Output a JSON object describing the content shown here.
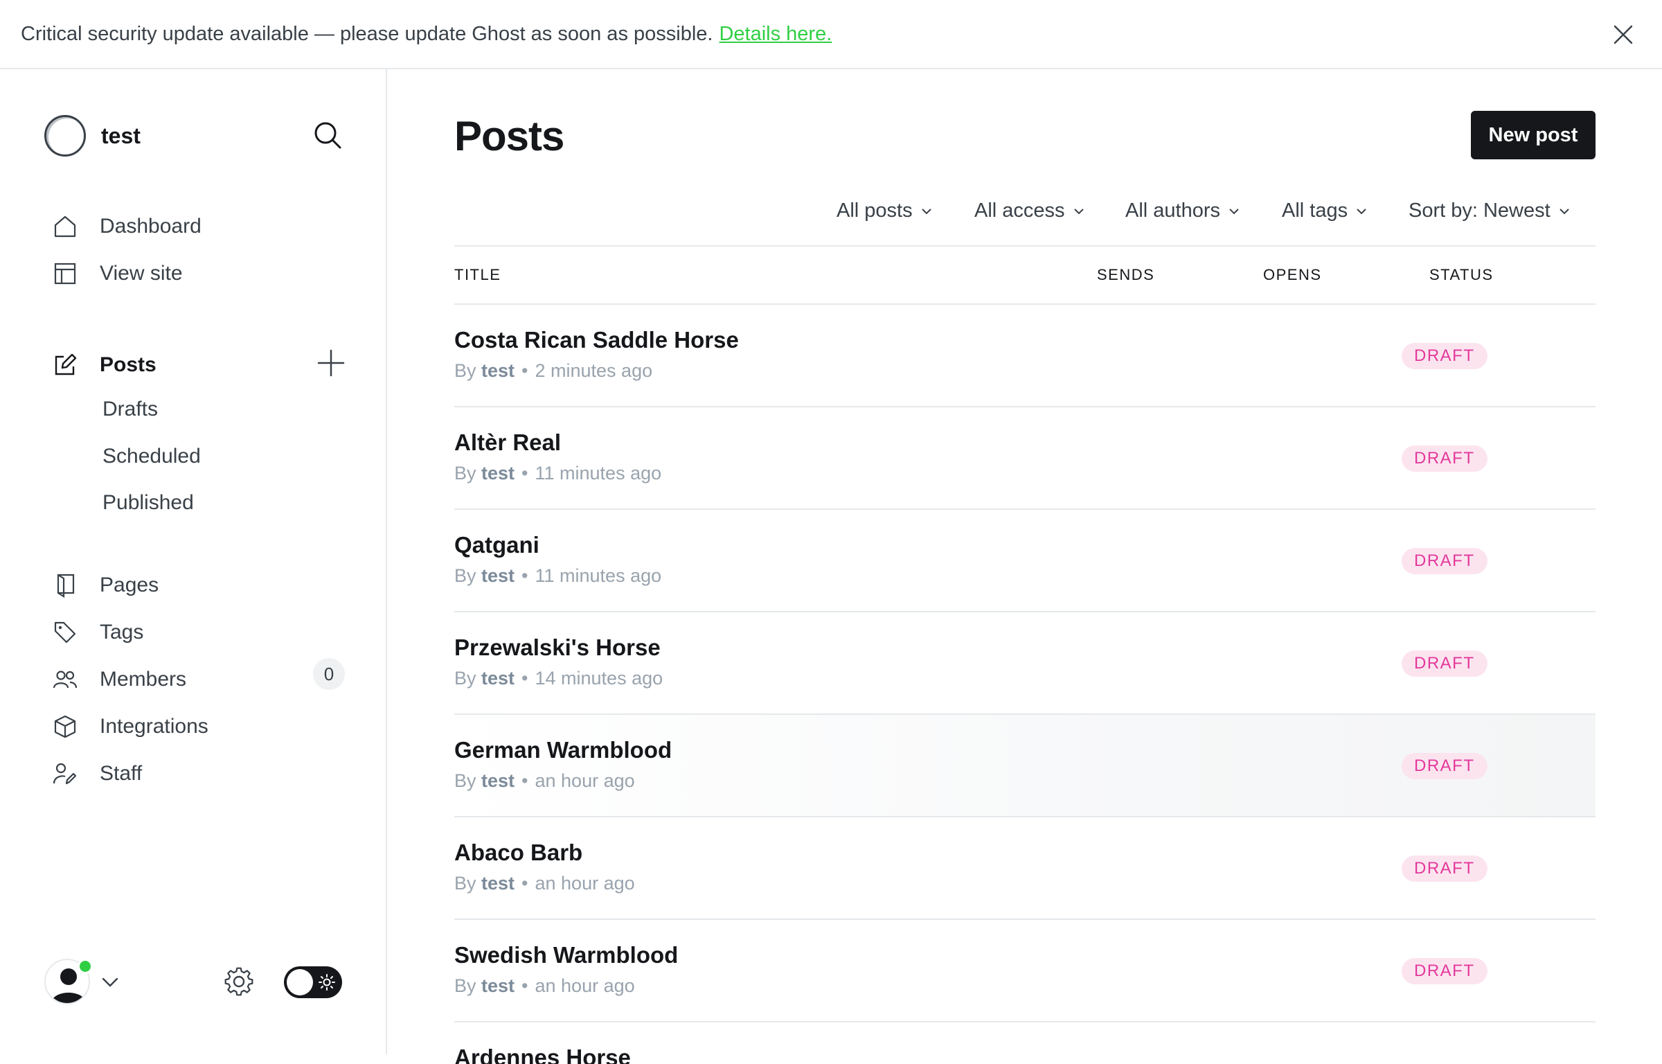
{
  "banner": {
    "message": "Critical security update available — please update Ghost as soon as possible.",
    "link_text": "Details here."
  },
  "sidebar": {
    "site_name": "test",
    "nav_primary": [
      {
        "label": "Dashboard",
        "icon": "home-icon"
      },
      {
        "label": "View site",
        "icon": "layout-icon"
      }
    ],
    "posts": {
      "label": "Posts",
      "icon": "edit-icon",
      "sub_items": [
        "Drafts",
        "Scheduled",
        "Published"
      ]
    },
    "nav_secondary": [
      {
        "label": "Pages",
        "icon": "page-icon"
      },
      {
        "label": "Tags",
        "icon": "tag-icon"
      },
      {
        "label": "Members",
        "icon": "members-icon",
        "count": "0"
      },
      {
        "label": "Integrations",
        "icon": "box-icon"
      },
      {
        "label": "Staff",
        "icon": "staff-icon"
      }
    ],
    "online_color": "#30cf43"
  },
  "main": {
    "title": "Posts",
    "new_post_label": "New post",
    "filters": [
      "All posts",
      "All access",
      "All authors",
      "All tags",
      "Sort by: Newest"
    ],
    "columns": [
      "TITLE",
      "SENDS",
      "OPENS",
      "STATUS"
    ],
    "posts": [
      {
        "title": "Costa Rican Saddle Horse",
        "by": "By",
        "author": "test",
        "time": "2 minutes ago",
        "status": "DRAFT"
      },
      {
        "title": "Altèr Real",
        "by": "By",
        "author": "test",
        "time": "11 minutes ago",
        "status": "DRAFT"
      },
      {
        "title": "Qatgani",
        "by": "By",
        "author": "test",
        "time": "11 minutes ago",
        "status": "DRAFT"
      },
      {
        "title": "Przewalski's Horse",
        "by": "By",
        "author": "test",
        "time": "14 minutes ago",
        "status": "DRAFT"
      },
      {
        "title": "German Warmblood",
        "by": "By",
        "author": "test",
        "time": "an hour ago",
        "status": "DRAFT"
      },
      {
        "title": "Abaco Barb",
        "by": "By",
        "author": "test",
        "time": "an hour ago",
        "status": "DRAFT"
      },
      {
        "title": "Swedish Warmblood",
        "by": "By",
        "author": "test",
        "time": "an hour ago",
        "status": "DRAFT"
      },
      {
        "title": "Ardennes Horse",
        "by": "",
        "author": "",
        "time": "",
        "status": ""
      }
    ],
    "draft_badge_color": "#e3389b"
  }
}
